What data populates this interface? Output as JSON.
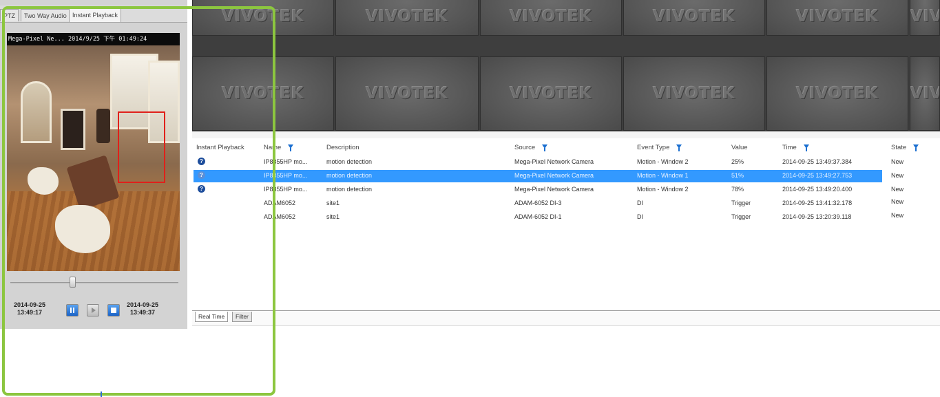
{
  "left_panel": {
    "tabs": [
      {
        "label": "PTZ"
      },
      {
        "label": "Two Way Audio"
      },
      {
        "label": "Instant Playback"
      }
    ],
    "video_overlay": "Mega-Pixel Ne... 2014/9/25 下午 01:49:24",
    "start_time": {
      "date": "2014-09-25",
      "time": "13:49:17"
    },
    "end_time": {
      "date": "2014-09-25",
      "time": "13:49:37"
    },
    "slider_position_fraction": 0.37
  },
  "camera_grid": {
    "logo_text": "VIVOTEK"
  },
  "event_table": {
    "columns": [
      "Instant Playback",
      "Name",
      "Description",
      "Source",
      "Event Type",
      "Value",
      "Time",
      "State"
    ],
    "rows": [
      {
        "has_playback": true,
        "name": "IP8355HP mo...",
        "description": "motion detection",
        "source": "Mega-Pixel Network Camera",
        "event_type": "Motion - Window 2",
        "value": "25%",
        "time": "2014-09-25 13:49:37.384",
        "state": "New",
        "selected": false
      },
      {
        "has_playback": true,
        "name": "IP8355HP mo...",
        "description": "motion detection",
        "source": "Mega-Pixel Network Camera",
        "event_type": "Motion - Window 1",
        "value": "51%",
        "time": "2014-09-25 13:49:27.753",
        "state": "New",
        "selected": true
      },
      {
        "has_playback": true,
        "name": "IP8355HP mo...",
        "description": "motion detection",
        "source": "Mega-Pixel Network Camera",
        "event_type": "Motion - Window 2",
        "value": "78%",
        "time": "2014-09-25 13:49:20.400",
        "state": "New",
        "selected": false
      },
      {
        "has_playback": false,
        "name": "ADAM6052",
        "description": "site1",
        "source": "ADAM-6052 DI-3",
        "event_type": "DI",
        "value": "Trigger",
        "time": "2014-09-25 13:41:32.178",
        "state": "New",
        "selected": false
      },
      {
        "has_playback": false,
        "name": "ADAM6052",
        "description": "site1",
        "source": "ADAM-6052 DI-1",
        "event_type": "DI",
        "value": "Trigger",
        "time": "2014-09-25 13:20:39.118",
        "state": "New",
        "selected": false
      }
    ],
    "bottom_tabs": [
      {
        "label": "Real Time"
      },
      {
        "label": "Filter"
      }
    ]
  },
  "colors": {
    "highlight_frame": "#8cc63f",
    "selection": "#3399ff",
    "motion_box": "#e0201a",
    "control_blue": "#1b63c6"
  }
}
